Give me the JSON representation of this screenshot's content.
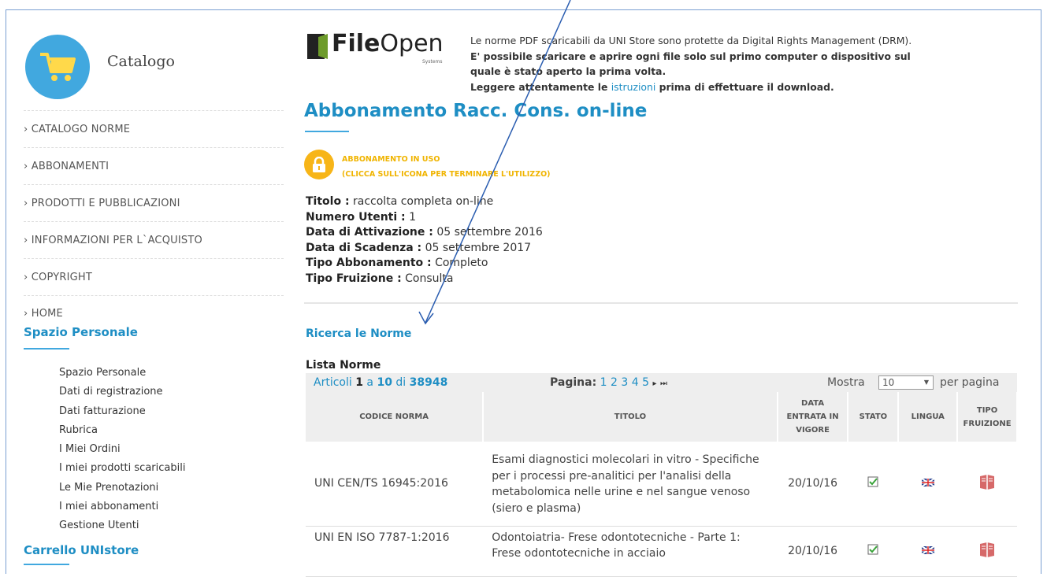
{
  "sidebar": {
    "logo_text": "Catalogo",
    "nav": [
      "› CATALOGO NORME",
      "› ABBONAMENTI",
      "› PRODOTTI E PUBBLICAZIONI",
      "› INFORMAZIONI PER L`ACQUISTO",
      "› COPYRIGHT",
      "› HOME"
    ],
    "personal_title": "Spazio Personale",
    "personal_items": [
      "Spazio Personale",
      "Dati di registrazione",
      "Dati fatturazione",
      "Rubrica",
      "I Miei Ordini",
      "I miei prodotti scaricabili",
      "Le Mie Prenotazioni",
      "I miei abbonamenti",
      "Gestione Utenti"
    ],
    "cart_title": "Carrello UNIstore"
  },
  "header": {
    "brand_bold": "File",
    "brand_light": "Open",
    "brand_sub": "Systems",
    "drm_line1": "Le norme PDF scaricabili da UNI Store sono protette da Digital Rights Management (DRM).",
    "drm_line2": "E' possibile scaricare e aprire ogni file solo sul primo computer o dispositivo sul",
    "drm_line3": "quale è stato aperto la prima volta.",
    "drm_line4_pre": "Leggere attentamente le ",
    "drm_link": "istruzioni",
    "drm_line4_post": " prima di effettuare il download."
  },
  "main": {
    "title": "Abbonamento Racc. Cons. on-line",
    "status_line1": "ABBONAMENTO IN USO",
    "status_line2": "(CLICCA SULL'ICONA PER TERMINARE L'UTILIZZO)",
    "details": [
      {
        "label": "Titolo :",
        "value": "raccolta completa on-line"
      },
      {
        "label": "Numero Utenti :",
        "value": "1"
      },
      {
        "label": "Data di Attivazione :",
        "value": "05 settembre 2016"
      },
      {
        "label": "Data di Scadenza :",
        "value": "05 settembre 2017"
      },
      {
        "label": "Tipo Abbonamento :",
        "value": "Completo"
      },
      {
        "label": "Tipo Fruizione :",
        "value": "Consulta"
      }
    ],
    "search_link": "Ricerca le Norme",
    "list_title": "Lista Norme"
  },
  "pager": {
    "articoli_pre": "Articoli ",
    "from": "1",
    "a": " a ",
    "to": "10",
    "di": " di ",
    "total": "38948",
    "pagina_label": "Pagina:",
    "pages": [
      "1",
      "2",
      "3",
      "4",
      "5"
    ],
    "next": "▸",
    "last": "⏭",
    "mostra": "Mostra",
    "per_page": "10",
    "per_pagina": "per pagina"
  },
  "table": {
    "headers": [
      "CODICE NORMA",
      "TITOLO",
      "DATA ENTRATA IN VIGORE",
      "STATO",
      "LINGUA",
      "TIPO FRUIZIONE"
    ],
    "rows": [
      {
        "code": "UNI CEN/TS 16945:2016",
        "title": "Esami diagnostici molecolari in vitro - Specifiche per i processi pre-analitici per l'analisi della metabolomica nelle urine e nel sangue venoso (siero e plasma)",
        "date": "20/10/16"
      },
      {
        "code": "UNI EN ISO 7787-1:2016",
        "title": "Odontoiatria- Frese odontotecniche - Parte 1: Frese odontotecniche in acciaio",
        "date": "20/10/16"
      }
    ]
  },
  "colors": {
    "accent": "#1e8ec4",
    "warning": "#f7b518",
    "annotation": "#2a5db0"
  }
}
